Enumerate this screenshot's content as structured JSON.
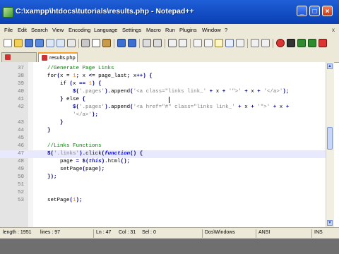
{
  "window": {
    "title": "C:\\xampp\\htdocs\\tutorials\\results.php - Notepad++",
    "minimize_label": "_",
    "maximize_label": "□",
    "close_label": "×"
  },
  "menu": {
    "items": [
      "File",
      "Edit",
      "Search",
      "View",
      "Encoding",
      "Language",
      "Settings",
      "Macro",
      "Run",
      "Plugins",
      "Window",
      "?"
    ],
    "close_label": "x"
  },
  "tabs": {
    "active_label": "results.php"
  },
  "editor": {
    "lines": [
      {
        "num": "37",
        "code": "    //Generate Page Links"
      },
      {
        "num": "38",
        "code": "    for(x = 1; x <= page_last; x++) {"
      },
      {
        "num": "39",
        "code": "        if (x == 1) {"
      },
      {
        "num": "40",
        "code": "            $('.pages').append('<a class=\"links link_' + x + '\">' + x + '</a>');"
      },
      {
        "num": "41",
        "code": "        } else {"
      },
      {
        "num": "42",
        "code": "            $('.pages').append('<a href=\"#\" class=\"links link_' + x + '\">' + x +"
      },
      {
        "num": "",
        "code": "            '</a>');"
      },
      {
        "num": "43",
        "code": "        }"
      },
      {
        "num": "44",
        "code": "    }"
      },
      {
        "num": "45",
        "code": ""
      },
      {
        "num": "46",
        "code": "    //Links Functions"
      },
      {
        "num": "47",
        "code": "    $('.links').click(function() {"
      },
      {
        "num": "48",
        "code": "        page = $(this).html();"
      },
      {
        "num": "49",
        "code": "        setPage(page);"
      },
      {
        "num": "50",
        "code": "    });"
      },
      {
        "num": "51",
        "code": ""
      },
      {
        "num": "52",
        "code": ""
      },
      {
        "num": "53",
        "code": "    setPage(1);"
      }
    ],
    "current_line_index": 11
  },
  "status": {
    "length": "length : 1951",
    "lines": "lines : 97",
    "ln": "Ln : 47",
    "col": "Col : 31",
    "sel": "Sel : 0",
    "eol": "Dos\\Windows",
    "encoding": "ANSI",
    "mode": "INS"
  },
  "colors": {
    "titlebar": "#0a3fb5",
    "keyword": "#0000ff",
    "comment": "#008000",
    "string": "#808080",
    "current_line": "#e8e8ff",
    "tab_accent": "#f9a02a"
  }
}
